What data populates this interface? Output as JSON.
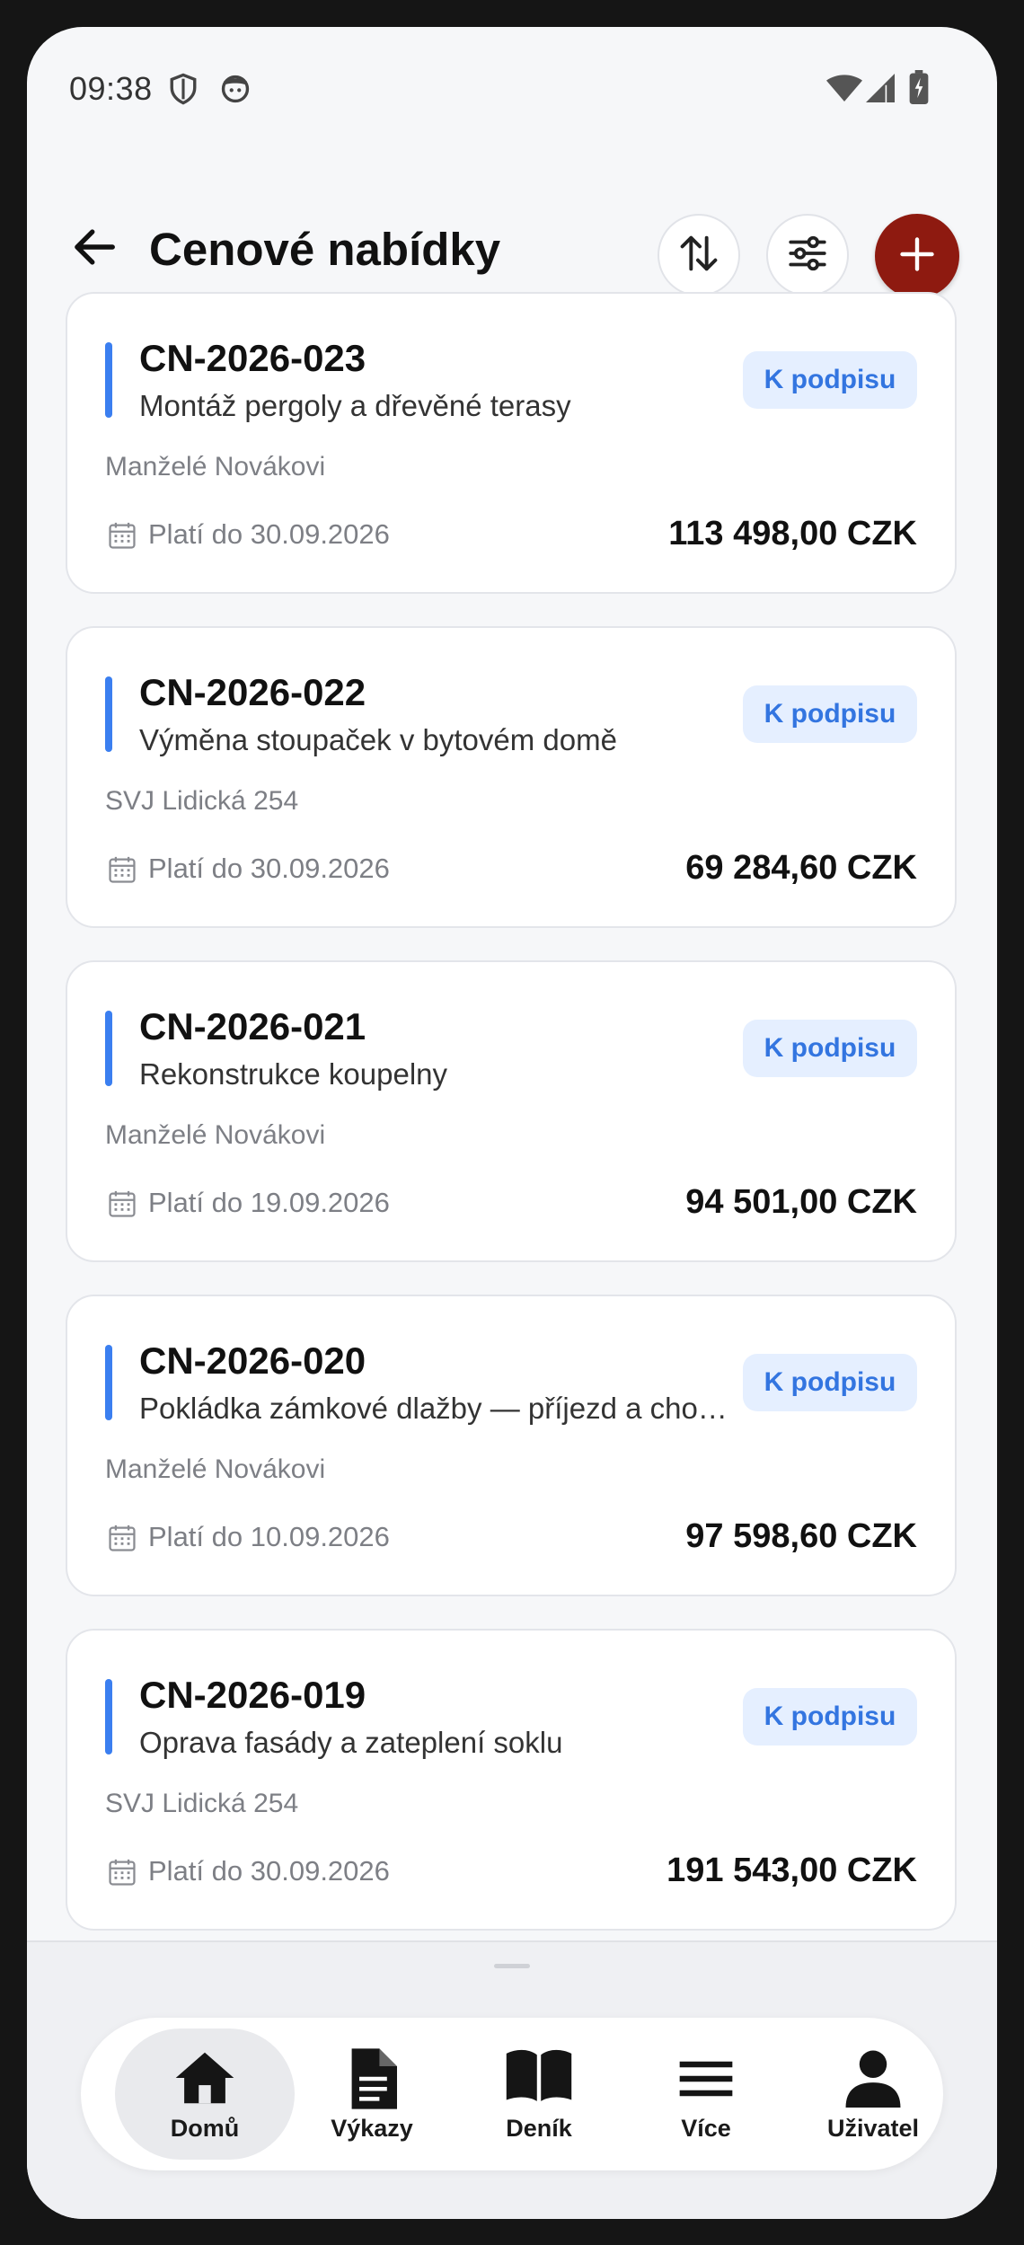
{
  "status_bar": {
    "time": "09:38"
  },
  "header": {
    "title": "Cenové nabídky"
  },
  "quotes": [
    {
      "code": "CN-2026-023",
      "description": "Montáž pergoly a dřevěné terasy",
      "client": "Manželé Novákovi",
      "valid_until": "Platí do 30.09.2026",
      "amount": "113 498,00 CZK",
      "status": "K podpisu"
    },
    {
      "code": "CN-2026-022",
      "description": "Výměna stoupaček v bytovém domě",
      "client": "SVJ Lidická 254",
      "valid_until": "Platí do 30.09.2026",
      "amount": "69 284,60 CZK",
      "status": "K podpisu"
    },
    {
      "code": "CN-2026-021",
      "description": "Rekonstrukce koupelny",
      "client": "Manželé Novákovi",
      "valid_until": "Platí do 19.09.2026",
      "amount": "94 501,00 CZK",
      "status": "K podpisu"
    },
    {
      "code": "CN-2026-020",
      "description": "Pokládka zámkové dlažby — příjezd a cho…",
      "client": "Manželé Novákovi",
      "valid_until": "Platí do 10.09.2026",
      "amount": "97 598,60 CZK",
      "status": "K podpisu"
    },
    {
      "code": "CN-2026-019",
      "description": "Oprava fasády a zateplení soklu",
      "client": "SVJ Lidická 254",
      "valid_until": "Platí do 30.09.2026",
      "amount": "191 543,00 CZK",
      "status": "K podpisu"
    }
  ],
  "nav": [
    {
      "label": "Domů",
      "icon": "home-icon",
      "active": true
    },
    {
      "label": "Výkazy",
      "icon": "document-icon"
    },
    {
      "label": "Deník",
      "icon": "book-icon"
    },
    {
      "label": "Více",
      "icon": "menu-icon"
    },
    {
      "label": "Uživatel",
      "icon": "user-icon"
    }
  ],
  "colors": {
    "accent": "#3b7ff0",
    "add_button": "#8e1a10",
    "badge_bg": "#e5efff",
    "badge_text": "#3375e0"
  }
}
